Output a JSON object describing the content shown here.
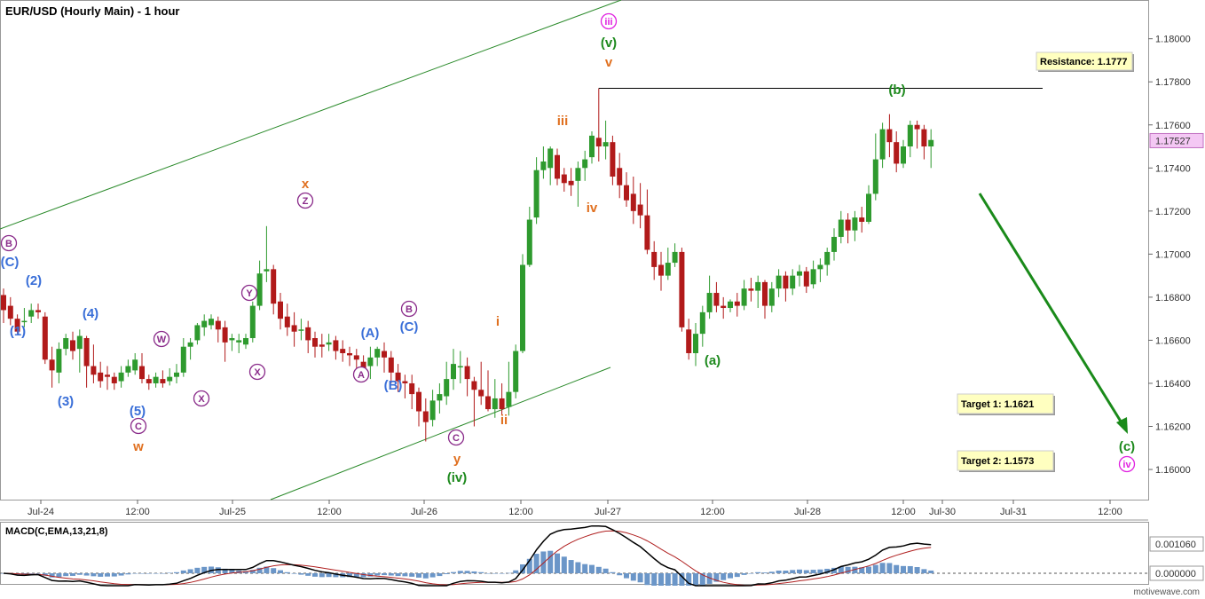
{
  "chart_data": {
    "type": "candlestick",
    "title": "EUR/USD (Hourly Main) - 1 hour",
    "y_axis": {
      "ylim": [
        1.1586,
        1.1818
      ],
      "ticks": [
        "1.18000",
        "1.17800",
        "1.17600",
        "1.17400",
        "1.17200",
        "1.17000",
        "1.16800",
        "1.16600",
        "1.16400",
        "1.16200",
        "1.16000"
      ],
      "tick_values": [
        1.18,
        1.178,
        1.176,
        1.174,
        1.172,
        1.17,
        1.168,
        1.166,
        1.164,
        1.162,
        1.16
      ],
      "current_price": "1.17527",
      "current_value": 1.17527
    },
    "x_axis": {
      "labels": [
        "Jul-24",
        "12:00",
        "Jul-25",
        "12:00",
        "Jul-26",
        "12:00",
        "Jul-27",
        "12:00",
        "Jul-28",
        "12:00",
        "Jul-30",
        "Jul-31",
        "12:00"
      ]
    },
    "candles": [
      [
        1.1681,
        1.1684,
        1.1674,
        1.1668
      ],
      [
        1.1676,
        1.168,
        1.167,
        1.1667
      ],
      [
        1.167,
        1.1672,
        1.1664,
        1.1663
      ],
      [
        1.1669,
        1.1675,
        1.1669,
        1.1666
      ],
      [
        1.1671,
        1.1677,
        1.1674,
        1.1668
      ],
      [
        1.1674,
        1.1677,
        1.1673,
        1.167
      ],
      [
        1.1671,
        1.1673,
        1.1651,
        1.1649
      ],
      [
        1.1651,
        1.1657,
        1.1646,
        1.1638
      ],
      [
        1.1645,
        1.1659,
        1.1656,
        1.164
      ],
      [
        1.1656,
        1.1663,
        1.1661,
        1.1653
      ],
      [
        1.166,
        1.1664,
        1.1655,
        1.1651
      ],
      [
        1.1656,
        1.1665,
        1.1662,
        1.1645
      ],
      [
        1.1661,
        1.1662,
        1.1648,
        1.1638
      ],
      [
        1.1648,
        1.1658,
        1.1644,
        1.164
      ],
      [
        1.1645,
        1.165,
        1.1641,
        1.1638
      ],
      [
        1.1644,
        1.1648,
        1.1643,
        1.1637
      ],
      [
        1.1643,
        1.1645,
        1.164,
        1.1637
      ],
      [
        1.1641,
        1.1648,
        1.1645,
        1.1638
      ],
      [
        1.1645,
        1.1651,
        1.1648,
        1.1643
      ],
      [
        1.1646,
        1.1654,
        1.1651,
        1.1644
      ],
      [
        1.1648,
        1.1654,
        1.1642,
        1.164
      ],
      [
        1.1642,
        1.1644,
        1.164,
        1.1637
      ],
      [
        1.164,
        1.1645,
        1.1643,
        1.1638
      ],
      [
        1.1642,
        1.1646,
        1.164,
        1.1638
      ],
      [
        1.1641,
        1.1647,
        1.1643,
        1.1639
      ],
      [
        1.1643,
        1.1649,
        1.1645,
        1.164
      ],
      [
        1.1645,
        1.1661,
        1.1657,
        1.1643
      ],
      [
        1.1657,
        1.1661,
        1.1659,
        1.1651
      ],
      [
        1.166,
        1.1668,
        1.1667,
        1.1658
      ],
      [
        1.1666,
        1.1672,
        1.1669,
        1.1662
      ],
      [
        1.1667,
        1.1672,
        1.167,
        1.1665
      ],
      [
        1.1669,
        1.1671,
        1.1665,
        1.1659
      ],
      [
        1.1666,
        1.1669,
        1.1659,
        1.165
      ],
      [
        1.166,
        1.1663,
        1.1661,
        1.1655
      ],
      [
        1.1659,
        1.1663,
        1.166,
        1.1654
      ],
      [
        1.1658,
        1.1663,
        1.1661,
        1.1656
      ],
      [
        1.1661,
        1.1678,
        1.1676,
        1.1659
      ],
      [
        1.1676,
        1.1697,
        1.1691,
        1.1674
      ],
      [
        1.1692,
        1.1713,
        1.1693,
        1.1687
      ],
      [
        1.1693,
        1.1695,
        1.1677,
        1.1672
      ],
      [
        1.1678,
        1.1682,
        1.167,
        1.1665
      ],
      [
        1.1671,
        1.1677,
        1.1666,
        1.1662
      ],
      [
        1.1667,
        1.1673,
        1.1664,
        1.1657
      ],
      [
        1.1665,
        1.167,
        1.1665,
        1.166
      ],
      [
        1.1666,
        1.1669,
        1.166,
        1.1654
      ],
      [
        1.1661,
        1.1664,
        1.1657,
        1.1652
      ],
      [
        1.1658,
        1.1663,
        1.1657,
        1.1652
      ],
      [
        1.1658,
        1.1663,
        1.1659,
        1.1655
      ],
      [
        1.166,
        1.1662,
        1.1655,
        1.1651
      ],
      [
        1.1656,
        1.166,
        1.1654,
        1.165
      ],
      [
        1.1654,
        1.1657,
        1.1653,
        1.1648
      ],
      [
        1.1653,
        1.1656,
        1.1651,
        1.1646
      ],
      [
        1.165,
        1.1653,
        1.1647,
        1.1641
      ],
      [
        1.1648,
        1.1657,
        1.1652,
        1.1642
      ],
      [
        1.1652,
        1.1657,
        1.1656,
        1.1648
      ],
      [
        1.1655,
        1.1659,
        1.1652,
        1.1645
      ],
      [
        1.1652,
        1.1655,
        1.1645,
        1.164
      ],
      [
        1.1645,
        1.1649,
        1.1641,
        1.1636
      ],
      [
        1.1641,
        1.1644,
        1.164,
        1.1633
      ],
      [
        1.164,
        1.1644,
        1.1635,
        1.1628
      ],
      [
        1.1636,
        1.1638,
        1.1627,
        1.162
      ],
      [
        1.1627,
        1.1633,
        1.1622,
        1.1613
      ],
      [
        1.1623,
        1.1637,
        1.1632,
        1.162
      ],
      [
        1.1632,
        1.164,
        1.1635,
        1.1626
      ],
      [
        1.1634,
        1.165,
        1.1642,
        1.163
      ],
      [
        1.1642,
        1.1656,
        1.1649,
        1.1637
      ],
      [
        1.1648,
        1.1655,
        1.1648,
        1.164
      ],
      [
        1.1648,
        1.1652,
        1.1642,
        1.1634
      ],
      [
        1.1641,
        1.1643,
        1.1637,
        1.162
      ],
      [
        1.1637,
        1.165,
        1.1634,
        1.163
      ],
      [
        1.1634,
        1.1646,
        1.1628,
        1.1627
      ],
      [
        1.1628,
        1.1642,
        1.1633,
        1.1624
      ],
      [
        1.1633,
        1.164,
        1.1628,
        1.1625
      ],
      [
        1.1629,
        1.165,
        1.1636,
        1.1625
      ],
      [
        1.1636,
        1.1658,
        1.1655,
        1.1633
      ],
      [
        1.1655,
        1.17,
        1.1695,
        1.1654
      ],
      [
        1.1695,
        1.1722,
        1.1716,
        1.1694
      ],
      [
        1.1717,
        1.1745,
        1.1739,
        1.1714
      ],
      [
        1.1739,
        1.175,
        1.1743,
        1.1735
      ],
      [
        1.174,
        1.175,
        1.1749,
        1.1732
      ],
      [
        1.1746,
        1.1749,
        1.1735,
        1.1732
      ],
      [
        1.1737,
        1.174,
        1.1733,
        1.1729
      ],
      [
        1.1734,
        1.174,
        1.1732,
        1.1727
      ],
      [
        1.1734,
        1.1743,
        1.174,
        1.1722
      ],
      [
        1.174,
        1.1748,
        1.1744,
        1.1734
      ],
      [
        1.1745,
        1.1757,
        1.1755,
        1.1742
      ],
      [
        1.1754,
        1.1777,
        1.175,
        1.1743
      ],
      [
        1.175,
        1.1762,
        1.1752,
        1.1744
      ],
      [
        1.1752,
        1.1755,
        1.1736,
        1.1732
      ],
      [
        1.174,
        1.1747,
        1.1732,
        1.1726
      ],
      [
        1.1732,
        1.1738,
        1.1725,
        1.1722
      ],
      [
        1.1728,
        1.1736,
        1.172,
        1.1714
      ],
      [
        1.1723,
        1.1733,
        1.1718,
        1.1712
      ],
      [
        1.1718,
        1.173,
        1.1702,
        1.17
      ],
      [
        1.1701,
        1.1706,
        1.1694,
        1.1688
      ],
      [
        1.1695,
        1.1701,
        1.169,
        1.1683
      ],
      [
        1.169,
        1.1703,
        1.1696,
        1.1688
      ],
      [
        1.1696,
        1.1705,
        1.1701,
        1.1694
      ],
      [
        1.1701,
        1.1703,
        1.1666,
        1.1664
      ],
      [
        1.1665,
        1.167,
        1.1654,
        1.1651
      ],
      [
        1.1654,
        1.1668,
        1.1663,
        1.1648
      ],
      [
        1.1663,
        1.1676,
        1.1673,
        1.1657
      ],
      [
        1.1673,
        1.169,
        1.1682,
        1.167
      ],
      [
        1.1682,
        1.1687,
        1.1676,
        1.1673
      ],
      [
        1.1676,
        1.168,
        1.1675,
        1.167
      ],
      [
        1.1675,
        1.1679,
        1.1678,
        1.1673
      ],
      [
        1.1678,
        1.1682,
        1.1676,
        1.1671
      ],
      [
        1.1676,
        1.1688,
        1.1684,
        1.1674
      ],
      [
        1.1684,
        1.1689,
        1.1683,
        1.1678
      ],
      [
        1.1683,
        1.169,
        1.1687,
        1.1675
      ],
      [
        1.1687,
        1.1688,
        1.1676,
        1.167
      ],
      [
        1.1676,
        1.1687,
        1.1684,
        1.1673
      ],
      [
        1.1684,
        1.1693,
        1.169,
        1.168
      ],
      [
        1.169,
        1.1692,
        1.1684,
        1.1678
      ],
      [
        1.1684,
        1.1693,
        1.169,
        1.1681
      ],
      [
        1.169,
        1.1695,
        1.1692,
        1.1685
      ],
      [
        1.1692,
        1.1694,
        1.1685,
        1.1682
      ],
      [
        1.1686,
        1.1697,
        1.1693,
        1.1684
      ],
      [
        1.1693,
        1.1698,
        1.1695,
        1.1687
      ],
      [
        1.1695,
        1.1703,
        1.1701,
        1.169
      ],
      [
        1.1701,
        1.1712,
        1.1708,
        1.1697
      ],
      [
        1.1708,
        1.172,
        1.1716,
        1.1705
      ],
      [
        1.1716,
        1.1719,
        1.1711,
        1.1705
      ],
      [
        1.1711,
        1.172,
        1.1717,
        1.1706
      ],
      [
        1.1717,
        1.1722,
        1.1715,
        1.171
      ],
      [
        1.1715,
        1.1732,
        1.1728,
        1.1714
      ],
      [
        1.1728,
        1.1756,
        1.1744,
        1.1725
      ],
      [
        1.1744,
        1.1761,
        1.1758,
        1.174
      ],
      [
        1.1758,
        1.1765,
        1.1752,
        1.1745
      ],
      [
        1.1752,
        1.1757,
        1.1742,
        1.1738
      ],
      [
        1.1742,
        1.1753,
        1.175,
        1.174
      ],
      [
        1.175,
        1.1762,
        1.176,
        1.1745
      ],
      [
        1.176,
        1.1762,
        1.1758,
        1.1749
      ],
      [
        1.1758,
        1.176,
        1.175,
        1.1744
      ],
      [
        1.175,
        1.1758,
        1.1753,
        1.174
      ]
    ],
    "macd": {
      "label": "MACD(C,EMA,13,21,8)",
      "ticks": [
        "0.001060",
        "0.000000"
      ],
      "tick_values": [
        0.00106,
        0.0
      ]
    },
    "price_labels": [
      {
        "text": "(1)",
        "color": "#3a6fd8"
      },
      {
        "text": "(2)",
        "color": "#3a6fd8"
      },
      {
        "text": "(3)",
        "color": "#3a6fd8"
      },
      {
        "text": "(4)",
        "color": "#3a6fd8"
      },
      {
        "text": "(5)",
        "color": "#3a6fd8"
      },
      {
        "text": "(C)",
        "color": "#3a6fd8"
      },
      {
        "text": "(A)",
        "color": "#3a6fd8"
      },
      {
        "text": "(B)",
        "color": "#3a6fd8"
      },
      {
        "text": "(C)",
        "color": "#3a6fd8"
      },
      {
        "text": "w",
        "color": "#e07020"
      },
      {
        "text": "x",
        "color": "#e07020"
      },
      {
        "text": "y",
        "color": "#e07020"
      },
      {
        "text": "i",
        "color": "#e07020"
      },
      {
        "text": "ii",
        "color": "#e07020"
      },
      {
        "text": "iii",
        "color": "#e07020"
      },
      {
        "text": "iv",
        "color": "#e07020"
      },
      {
        "text": "v",
        "color": "#e07020"
      },
      {
        "text": "(iv)",
        "color": "#1e8a1e"
      },
      {
        "text": "(v)",
        "color": "#1e8a1e"
      },
      {
        "text": "(a)",
        "color": "#1e8a1e"
      },
      {
        "text": "(b)",
        "color": "#1e8a1e"
      },
      {
        "text": "(c)",
        "color": "#1e8a1e"
      }
    ],
    "circled_labels": [
      {
        "text": "B",
        "color": "#8a2b8a"
      },
      {
        "text": "C",
        "color": "#8a2b8a"
      },
      {
        "text": "W",
        "color": "#8a2b8a"
      },
      {
        "text": "X",
        "color": "#8a2b8a"
      },
      {
        "text": "Y",
        "color": "#8a2b8a"
      },
      {
        "text": "X",
        "color": "#8a2b8a"
      },
      {
        "text": "Z",
        "color": "#8a2b8a"
      },
      {
        "text": "A",
        "color": "#8a2b8a"
      },
      {
        "text": "B",
        "color": "#8a2b8a"
      },
      {
        "text": "C",
        "color": "#8a2b8a"
      },
      {
        "text": "iii",
        "color": "#e020e0"
      },
      {
        "text": "iv",
        "color": "#e020e0"
      }
    ],
    "boxes": [
      {
        "text": "Resistance:  1.1777"
      },
      {
        "text": "Target 1:  1.1621"
      },
      {
        "text": "Target 2:  1.1573"
      }
    ],
    "watermark": "motivewave.com",
    "colors": {
      "up": "#2e9a2e",
      "down": "#b11a1a",
      "channel": "#2a8a2a",
      "arrow": "#1a8a1a",
      "hist": "#6b96c8",
      "macd": "#000000",
      "signal": "#b02020"
    }
  }
}
